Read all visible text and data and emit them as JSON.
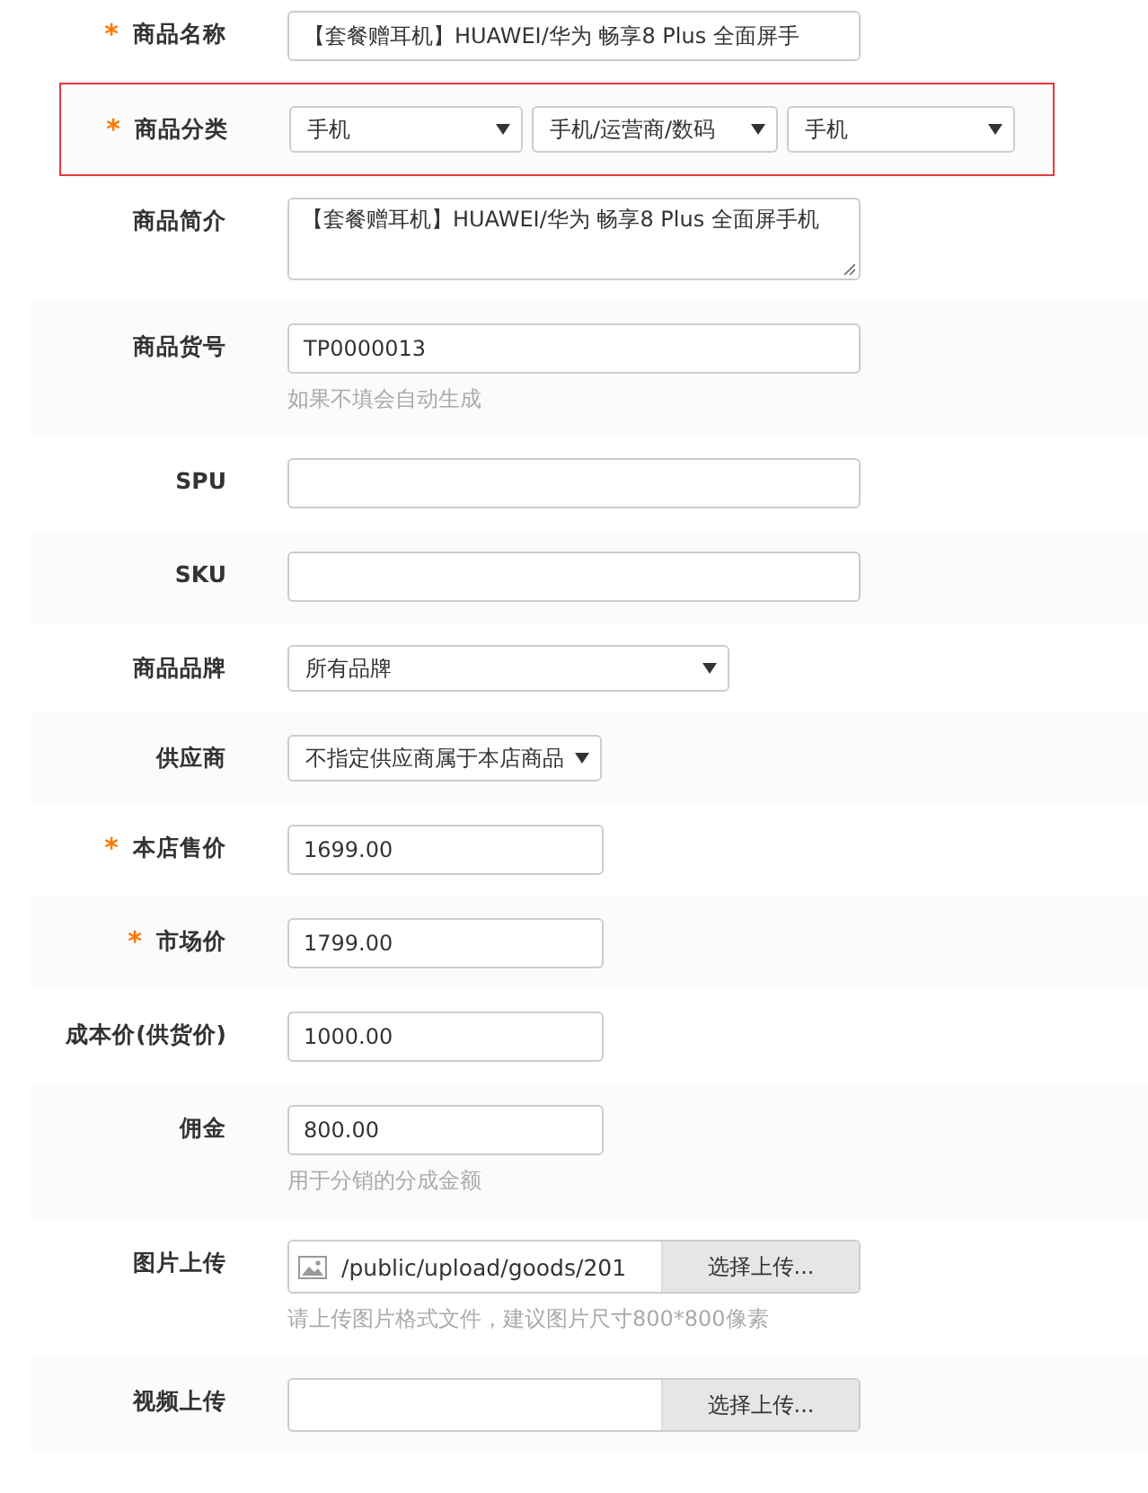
{
  "form": {
    "rows": [
      {
        "kind": "text",
        "label": "商品名称",
        "mark": "*",
        "value": "【套餐赠耳机】HUAWEI/华为 畅享8 Plus 全面屏手",
        "highlighted": false
      },
      {
        "kind": "selects",
        "label": "商品分类",
        "mark": "*",
        "options": [
          "手机",
          "手机/运营商/数码",
          "手机"
        ],
        "highlighted": true
      },
      {
        "kind": "textarea",
        "label": "商品简介",
        "value": "【套餐赠耳机】HUAWEI/华为 畅享8 Plus 全面屏手机",
        "highlighted": false
      },
      {
        "kind": "text",
        "label": "商品货号",
        "value": "TP0000013",
        "hint": "如果不填会自动生成",
        "highlighted": false
      },
      {
        "kind": "text",
        "label": "SPU",
        "highlighted": false
      },
      {
        "kind": "text",
        "label": "SKU",
        "highlighted": false
      },
      {
        "kind": "select",
        "label": "商品品牌",
        "value": "所有品牌",
        "highlighted": false
      },
      {
        "kind": "picker",
        "label": "供应商",
        "value": "不指定供应商属于本店商品",
        "highlighted": false
      },
      {
        "kind": "price",
        "label": "本店售价",
        "mark": "*",
        "value": "1699.00",
        "highlighted": false
      },
      {
        "kind": "price",
        "label": "市场价",
        "mark": "*",
        "value": "1799.00",
        "highlighted": false
      },
      {
        "kind": "price",
        "label": "成本价(供货价)",
        "value": "1000.00",
        "highlighted": false
      },
      {
        "kind": "price",
        "label": "佣金",
        "value": "800.00",
        "hint": "用于分销的分成金额",
        "highlighted": false
      },
      {
        "kind": "upload",
        "label": "图片上传",
        "value": "/public/upload/goods/201",
        "button": "选择上传...",
        "hint": "请上传图片格式文件，建议图片尺寸800*800像素",
        "highlighted": false
      },
      {
        "kind": "upload",
        "label": "视频上传",
        "button": "选择上传...",
        "highlighted": false
      }
    ]
  }
}
